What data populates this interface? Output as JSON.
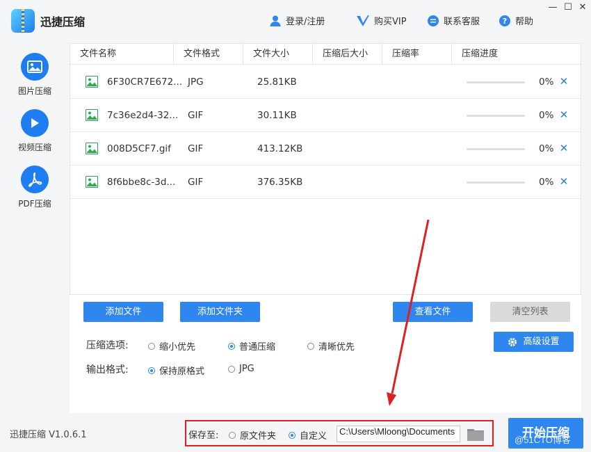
{
  "app": {
    "title": "迅捷压缩",
    "version": "迅捷压缩 V1.0.6.1"
  },
  "header": {
    "login": "登录/注册",
    "buy_vip": "购买VIP",
    "service": "联系客服",
    "help": "帮助"
  },
  "window_controls": {
    "minimize": "—",
    "maximize": "☐",
    "close": "✕"
  },
  "sidebar": {
    "items": [
      {
        "label": "图片压缩",
        "icon": "image-icon"
      },
      {
        "label": "视频压缩",
        "icon": "play-icon"
      },
      {
        "label": "PDF压缩",
        "icon": "pdf-icon"
      }
    ]
  },
  "table": {
    "headers": [
      "文件名称",
      "文件格式",
      "文件大小",
      "压缩后大小",
      "压缩率",
      "压缩进度"
    ],
    "rows": [
      {
        "name": "6F30CR7E672...",
        "format": "JPG",
        "size": "25.81KB",
        "after": "",
        "ratio": "",
        "progress": 0,
        "progress_text": "0%"
      },
      {
        "name": "7c36e2d4-32...",
        "format": "GIF",
        "size": "30.11KB",
        "after": "",
        "ratio": "",
        "progress": 0,
        "progress_text": "0%"
      },
      {
        "name": "008D5CF7.gif",
        "format": "GIF",
        "size": "413.12KB",
        "after": "",
        "ratio": "",
        "progress": 0,
        "progress_text": "0%"
      },
      {
        "name": "8f6bbe8c-3d...",
        "format": "GIF",
        "size": "376.35KB",
        "after": "",
        "ratio": "",
        "progress": 0,
        "progress_text": "0%"
      }
    ]
  },
  "actions": {
    "add_file": "添加文件",
    "add_folder": "添加文件夹",
    "view_files": "查看文件",
    "clear_list": "清空列表",
    "advanced": "高级设置"
  },
  "compress_options": {
    "label": "压缩选项:",
    "options": [
      "缩小优先",
      "普通压缩",
      "清晰优先"
    ],
    "selected": "普通压缩"
  },
  "output_format": {
    "label": "输出格式:",
    "options": [
      "保持原格式",
      "JPG"
    ],
    "selected": "保持原格式"
  },
  "save": {
    "label": "保存至:",
    "options": [
      "原文件夹",
      "自定义"
    ],
    "selected": "自定义",
    "path": "C:\\Users\\Mloong\\Documents"
  },
  "start_button": "开始压缩",
  "watermark": "@51CTO博客",
  "colors": {
    "accent": "#2f86ee",
    "highlight_box": "#e02020",
    "arrow": "#e02020"
  }
}
